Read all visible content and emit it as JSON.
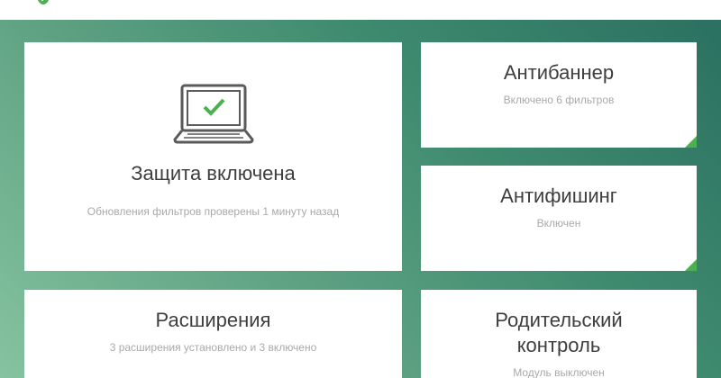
{
  "app": {
    "brand_color": "#4caf50",
    "logo_icon": "shield-check-icon"
  },
  "tiles": {
    "protection": {
      "icon": "laptop-check-icon",
      "title": "Защита включена",
      "subtitle": "Обновления фильтров проверены 1 минуту назад"
    },
    "antibanner": {
      "title": "Антибаннер",
      "subtitle": "Включено 6 фильтров",
      "status_color": "#4caf50"
    },
    "antiphishing": {
      "title": "Антифишинг",
      "subtitle": "Включен",
      "status_color": "#4caf50"
    },
    "extensions": {
      "title": "Расширения",
      "subtitle": "3 расширения установлено и 3 включено"
    },
    "parental": {
      "title": "Родительский контроль",
      "subtitle": "Модуль выключен"
    }
  }
}
